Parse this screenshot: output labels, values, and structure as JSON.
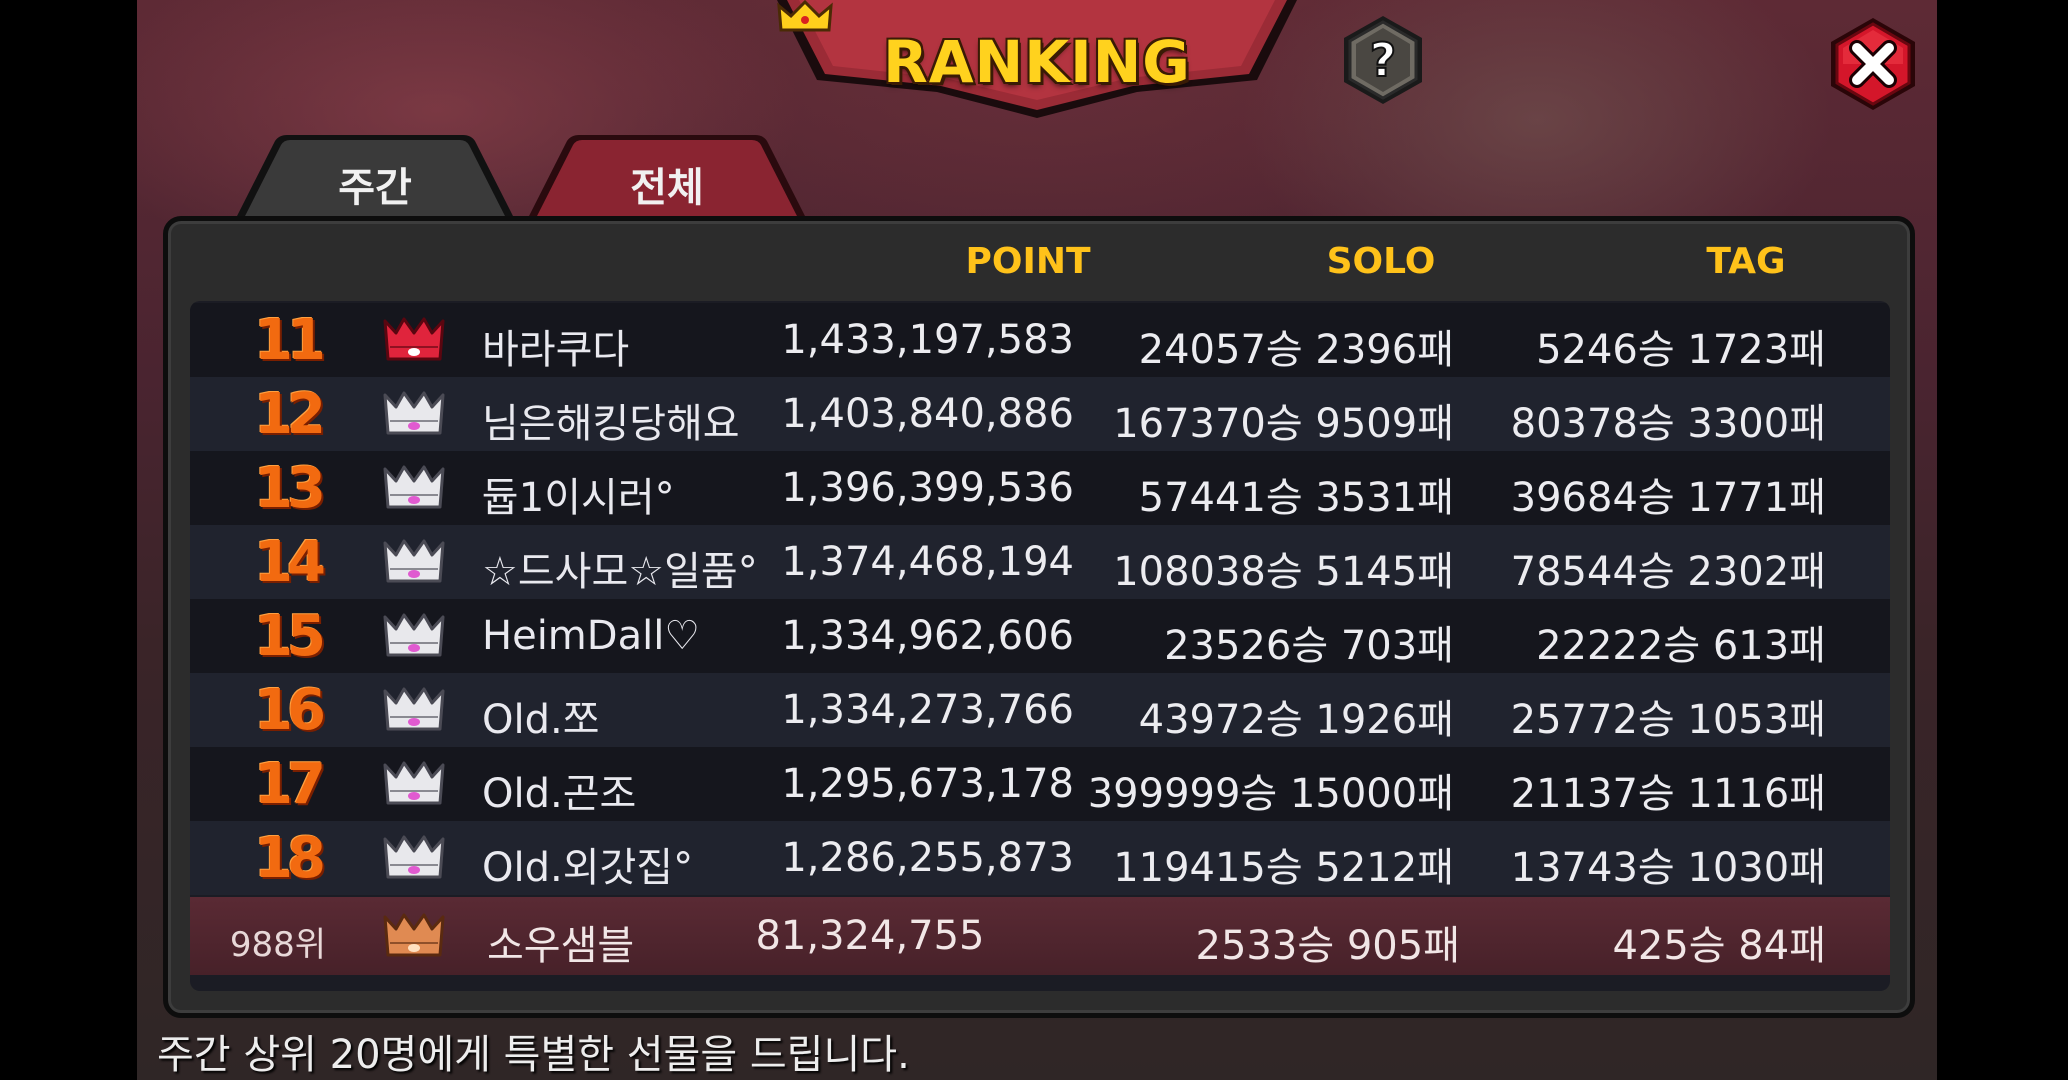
{
  "title": "RANKING",
  "tabs": [
    {
      "label": "주간"
    },
    {
      "label": "전체"
    }
  ],
  "columns": {
    "point": "POINT",
    "solo": "SOLO",
    "tag": "TAG"
  },
  "rows": [
    {
      "rank": "11",
      "name": "바라쿠다",
      "point": "1,433,197,583",
      "solo": "24057승 2396패",
      "tag": "5246승 1723패",
      "crown": "red-crown-icon"
    },
    {
      "rank": "12",
      "name": "님은해킹당해요",
      "point": "1,403,840,886",
      "solo": "167370승 9509패",
      "tag": "80378승 3300패",
      "crown": "silver-crown-icon"
    },
    {
      "rank": "13",
      "name": "듑1이시러°",
      "point": "1,396,399,536",
      "solo": "57441승 3531패",
      "tag": "39684승 1771패",
      "crown": "silver-crown-icon"
    },
    {
      "rank": "14",
      "name": "☆드사모☆일품°",
      "point": "1,374,468,194",
      "solo": "108038승 5145패",
      "tag": "78544승 2302패",
      "crown": "silver-crown-icon"
    },
    {
      "rank": "15",
      "name": "HeimDall♡",
      "point": "1,334,962,606",
      "solo": "23526승 703패",
      "tag": "22222승 613패",
      "crown": "silver-crown-icon"
    },
    {
      "rank": "16",
      "name": "Old.쪼",
      "point": "1,334,273,766",
      "solo": "43972승 1926패",
      "tag": "25772승 1053패",
      "crown": "silver-crown-icon"
    },
    {
      "rank": "17",
      "name": "Old.곤조",
      "point": "1,295,673,178",
      "solo": "399999승 15000패",
      "tag": "21137승 1116패",
      "crown": "silver-crown-icon"
    },
    {
      "rank": "18",
      "name": "Old.외갓집°",
      "point": "1,286,255,873",
      "solo": "119415승 5212패",
      "tag": "13743승 1030패",
      "crown": "silver-crown-icon"
    }
  ],
  "my_rank": {
    "rank": "988위",
    "name": "소우샘블",
    "point": "81,324,755",
    "solo": "2533승 905패",
    "tag": "425승 84패",
    "crown": "bronze-crown-icon"
  },
  "footer": "주간 상위 20명에게 특별한 선물을 드립니다.",
  "icons": {
    "help": "question-mark-icon",
    "close": "close-icon"
  },
  "colors": {
    "accent_gold": "#ffc21a",
    "rank_orange": "#f26a10",
    "close_red": "#d4162a",
    "tab_active_red": "#8a2431"
  }
}
